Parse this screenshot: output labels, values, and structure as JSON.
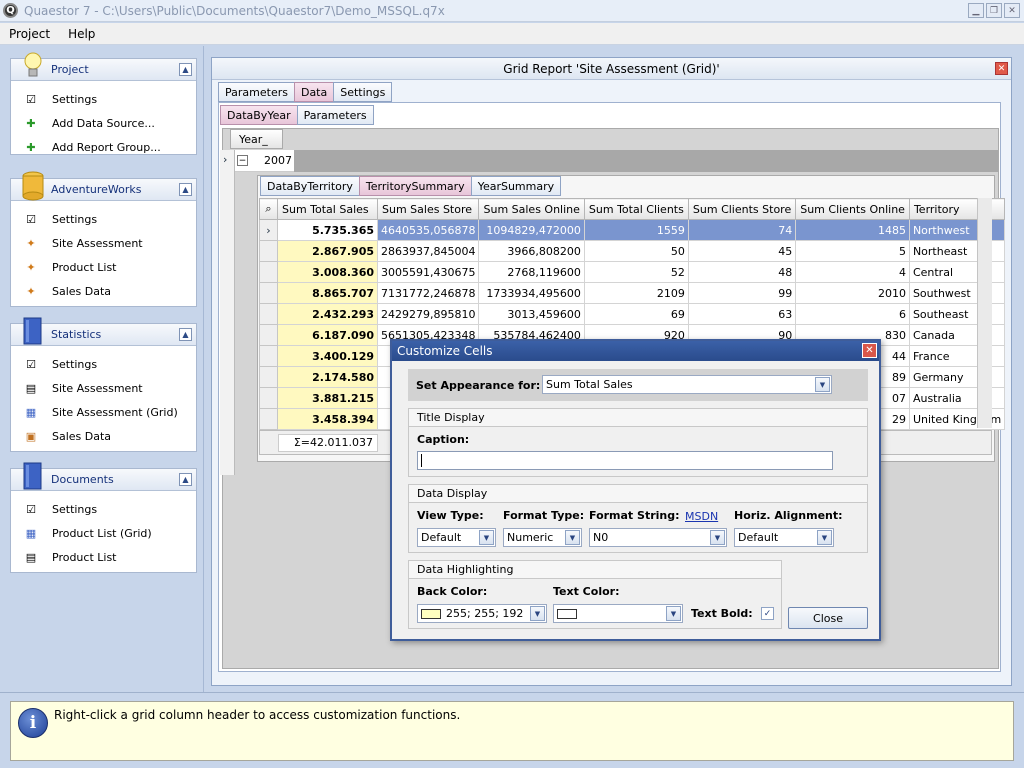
{
  "window": {
    "title": "Quaestor 7 - C:\\Users\\Public\\Documents\\Quaestor7\\Demo_MSSQL.q7x"
  },
  "menu": [
    {
      "label": "Project"
    },
    {
      "label": "Help"
    }
  ],
  "groups": [
    {
      "title": "Project",
      "items": [
        "Settings",
        "Add Data Source...",
        "Add Report Group..."
      ]
    },
    {
      "title": "AdventureWorks",
      "items": [
        "Settings",
        "Site Assessment",
        "Product List",
        "Sales Data"
      ]
    },
    {
      "title": "Statistics",
      "items": [
        "Settings",
        "Site Assessment",
        "Site Assessment (Grid)",
        "Sales Data"
      ]
    },
    {
      "title": "Documents",
      "items": [
        "Settings",
        "Product List (Grid)",
        "Product List"
      ]
    }
  ],
  "report": {
    "title": "Grid Report 'Site Assessment (Grid)'",
    "tabs": [
      "Parameters",
      "Data",
      "Settings"
    ],
    "subtabs": [
      "DataByYear",
      "Parameters"
    ],
    "year_header": "Year_",
    "year_value": "2007",
    "inner_tabs": [
      "DataByTerritory",
      "TerritorySummary",
      "YearSummary"
    ],
    "columns": [
      "Sum Total Sales",
      "Sum Sales Store",
      "Sum Sales Online",
      "Sum Total Clients",
      "Sum Clients Store",
      "Sum Clients Online",
      "Territory"
    ],
    "rows": [
      [
        "5.735.365",
        "4640535,056878",
        "1094829,472000",
        "1559",
        "74",
        "1485",
        "Northwest"
      ],
      [
        "2.867.905",
        "2863937,845004",
        "3966,808200",
        "50",
        "45",
        "5",
        "Northeast"
      ],
      [
        "3.008.360",
        "3005591,430675",
        "2768,119600",
        "52",
        "48",
        "4",
        "Central"
      ],
      [
        "8.865.707",
        "7131772,246878",
        "1733934,495600",
        "2109",
        "99",
        "2010",
        "Southwest"
      ],
      [
        "2.432.293",
        "2429279,895810",
        "3013,459600",
        "69",
        "63",
        "6",
        "Southeast"
      ],
      [
        "6.187.090",
        "5651305,423348",
        "535784,462400",
        "920",
        "90",
        "830",
        "Canada"
      ],
      [
        "3.400.129",
        "",
        "",
        "",
        "",
        "44",
        "France"
      ],
      [
        "2.174.580",
        "",
        "",
        "",
        "",
        "89",
        "Germany"
      ],
      [
        "3.881.215",
        "",
        "",
        "",
        "",
        "07",
        "Australia"
      ],
      [
        "3.458.394",
        "",
        "",
        "",
        "",
        "29",
        "United Kingdom"
      ]
    ],
    "sum_value": "Σ=42.011.037"
  },
  "dialog": {
    "title": "Customize Cells",
    "appearance_label": "Set Appearance for:",
    "appearance_value": "Sum Total Sales",
    "title_display": "Title Display",
    "caption_label": "Caption:",
    "caption_value": "",
    "data_display": "Data Display",
    "view_type_label": "View Type:",
    "view_type_value": "Default",
    "format_type_label": "Format Type:",
    "format_type_value": "Numeric",
    "format_string_label": "Format String:",
    "msdn_link": "MSDN",
    "format_string_value": "N0",
    "horiz_align_label": "Horiz. Alignment:",
    "horiz_align_value": "Default",
    "data_highlighting": "Data Highlighting",
    "back_color_label": "Back Color:",
    "back_color_value": "255; 255; 192",
    "back_color_hex": "#ffffc0",
    "text_color_label": "Text Color:",
    "text_color_value": "",
    "text_bold_label": "Text Bold:",
    "text_bold_checked": true,
    "close_label": "Close"
  },
  "status": {
    "text": "Right-click a grid column header to access customization functions."
  }
}
